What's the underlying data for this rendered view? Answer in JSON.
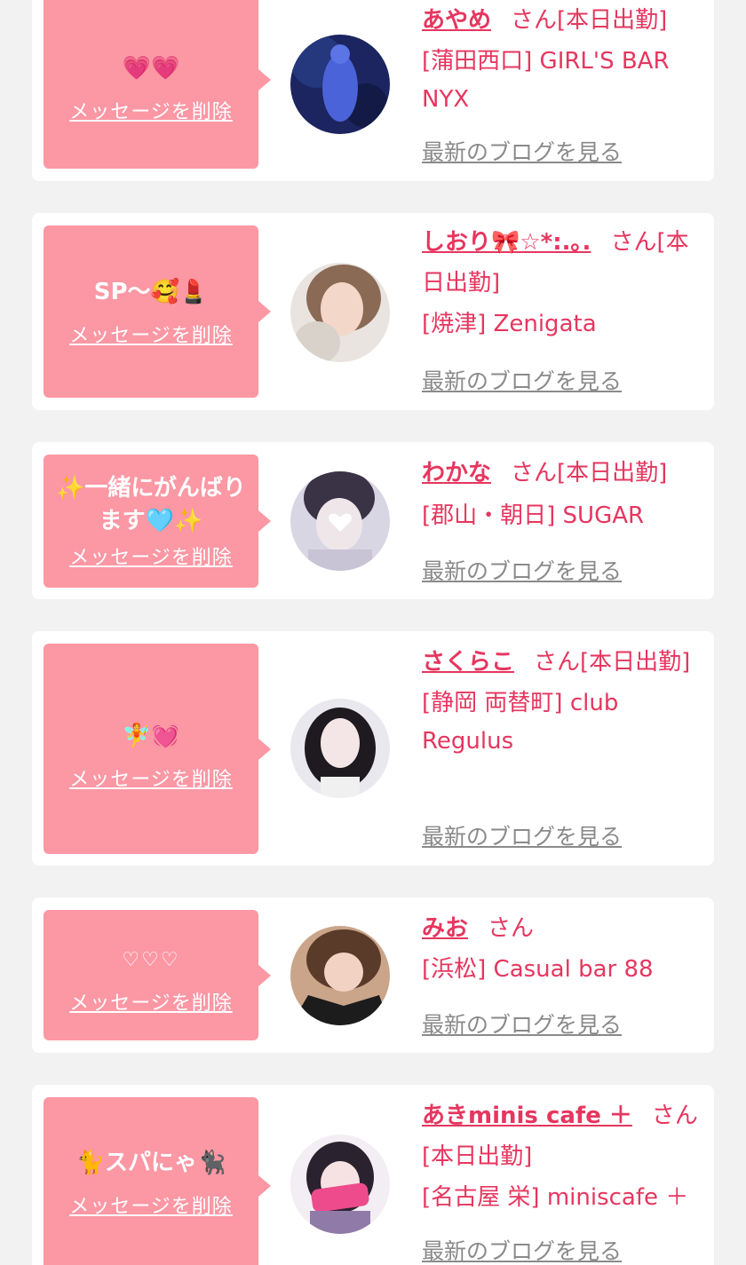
{
  "delete_label": "メッセージを削除",
  "blog_label": "最新のブログを見る",
  "san_label": "さん",
  "colors": {
    "background": "#f2f2f2",
    "card": "#ffffff",
    "bubble": "#fc97a4",
    "name_text": "#e6365f",
    "blog_text": "#8a8a8a"
  },
  "entries": [
    {
      "message": "💗💗",
      "name": "あやめ",
      "status": "[本日出勤]",
      "shop": "[蒲田西口] GIRL'S BAR NYX",
      "avatar_icon": "profile-photo"
    },
    {
      "message": "SP〜🥰💄",
      "name": "しおり🎀☆*:.｡.",
      "status": "[本日出勤]",
      "shop": "[焼津] Zenigata",
      "avatar_icon": "profile-photo"
    },
    {
      "message": "✨一緒にがんばります🩵✨",
      "name": "わかな",
      "status": "[本日出勤]",
      "shop": "[郡山・朝日] SUGAR",
      "avatar_icon": "profile-photo"
    },
    {
      "message": "🧚💓",
      "name": "さくらこ",
      "status": "[本日出勤]",
      "shop": "[静岡 両替町] club Regulus",
      "avatar_icon": "profile-photo"
    },
    {
      "message": "♡♡♡",
      "name": "みお",
      "status": "",
      "shop": "[浜松] Casual bar 88",
      "avatar_icon": "profile-photo"
    },
    {
      "message": "🐈スパにゃ🐈‍⬛",
      "name": "あきminis cafe ＋",
      "status": "[本日出勤]",
      "shop": "[名古屋 栄] miniscafe ＋",
      "avatar_icon": "profile-photo"
    }
  ]
}
